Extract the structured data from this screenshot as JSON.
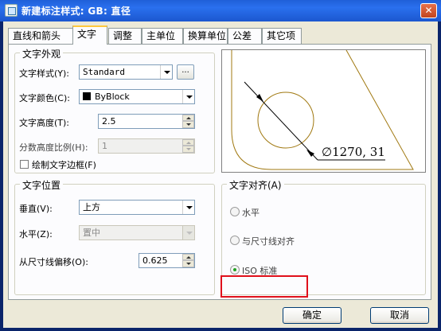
{
  "window": {
    "title": "新建标注样式: GB: 直径",
    "close_label": "✕"
  },
  "tabs": [
    {
      "label": "直线和箭头",
      "active": false
    },
    {
      "label": "文字",
      "active": true
    },
    {
      "label": "调整",
      "active": false
    },
    {
      "label": "主单位",
      "active": false
    },
    {
      "label": "换算单位",
      "active": false
    },
    {
      "label": "公差",
      "active": false
    },
    {
      "label": "其它项",
      "active": false
    }
  ],
  "text_appearance": {
    "title": "文字外观",
    "style_label": "文字样式(Y):",
    "style_value": "Standard",
    "style_browse_label": "...",
    "color_label": "文字颜色(C):",
    "color_value": "ByBlock",
    "color_swatch": "#000000",
    "height_label": "文字高度(T):",
    "height_value": "2.5",
    "fraction_label": "分数高度比例(H):",
    "fraction_value": "1",
    "frame_label": "绘制文字边框(F)"
  },
  "text_placement": {
    "title": "文字位置",
    "vertical_label": "垂直(V):",
    "vertical_value": "上方",
    "horizontal_label": "水平(Z):",
    "horizontal_value": "置中",
    "offset_label": "从尺寸线偏移(O):",
    "offset_value": "0.625"
  },
  "preview": {
    "dimension_text": "∅1270, 31",
    "line_color": "#a07810"
  },
  "text_alignment": {
    "title": "文字对齐(A)",
    "options": [
      {
        "label": "水平",
        "selected": false
      },
      {
        "label": "与尺寸线对齐",
        "selected": false
      },
      {
        "label": "ISO 标准",
        "selected": true
      }
    ],
    "highlight_color": "#e0101b"
  },
  "footer": {
    "ok_label": "确定",
    "cancel_label": "取消"
  }
}
